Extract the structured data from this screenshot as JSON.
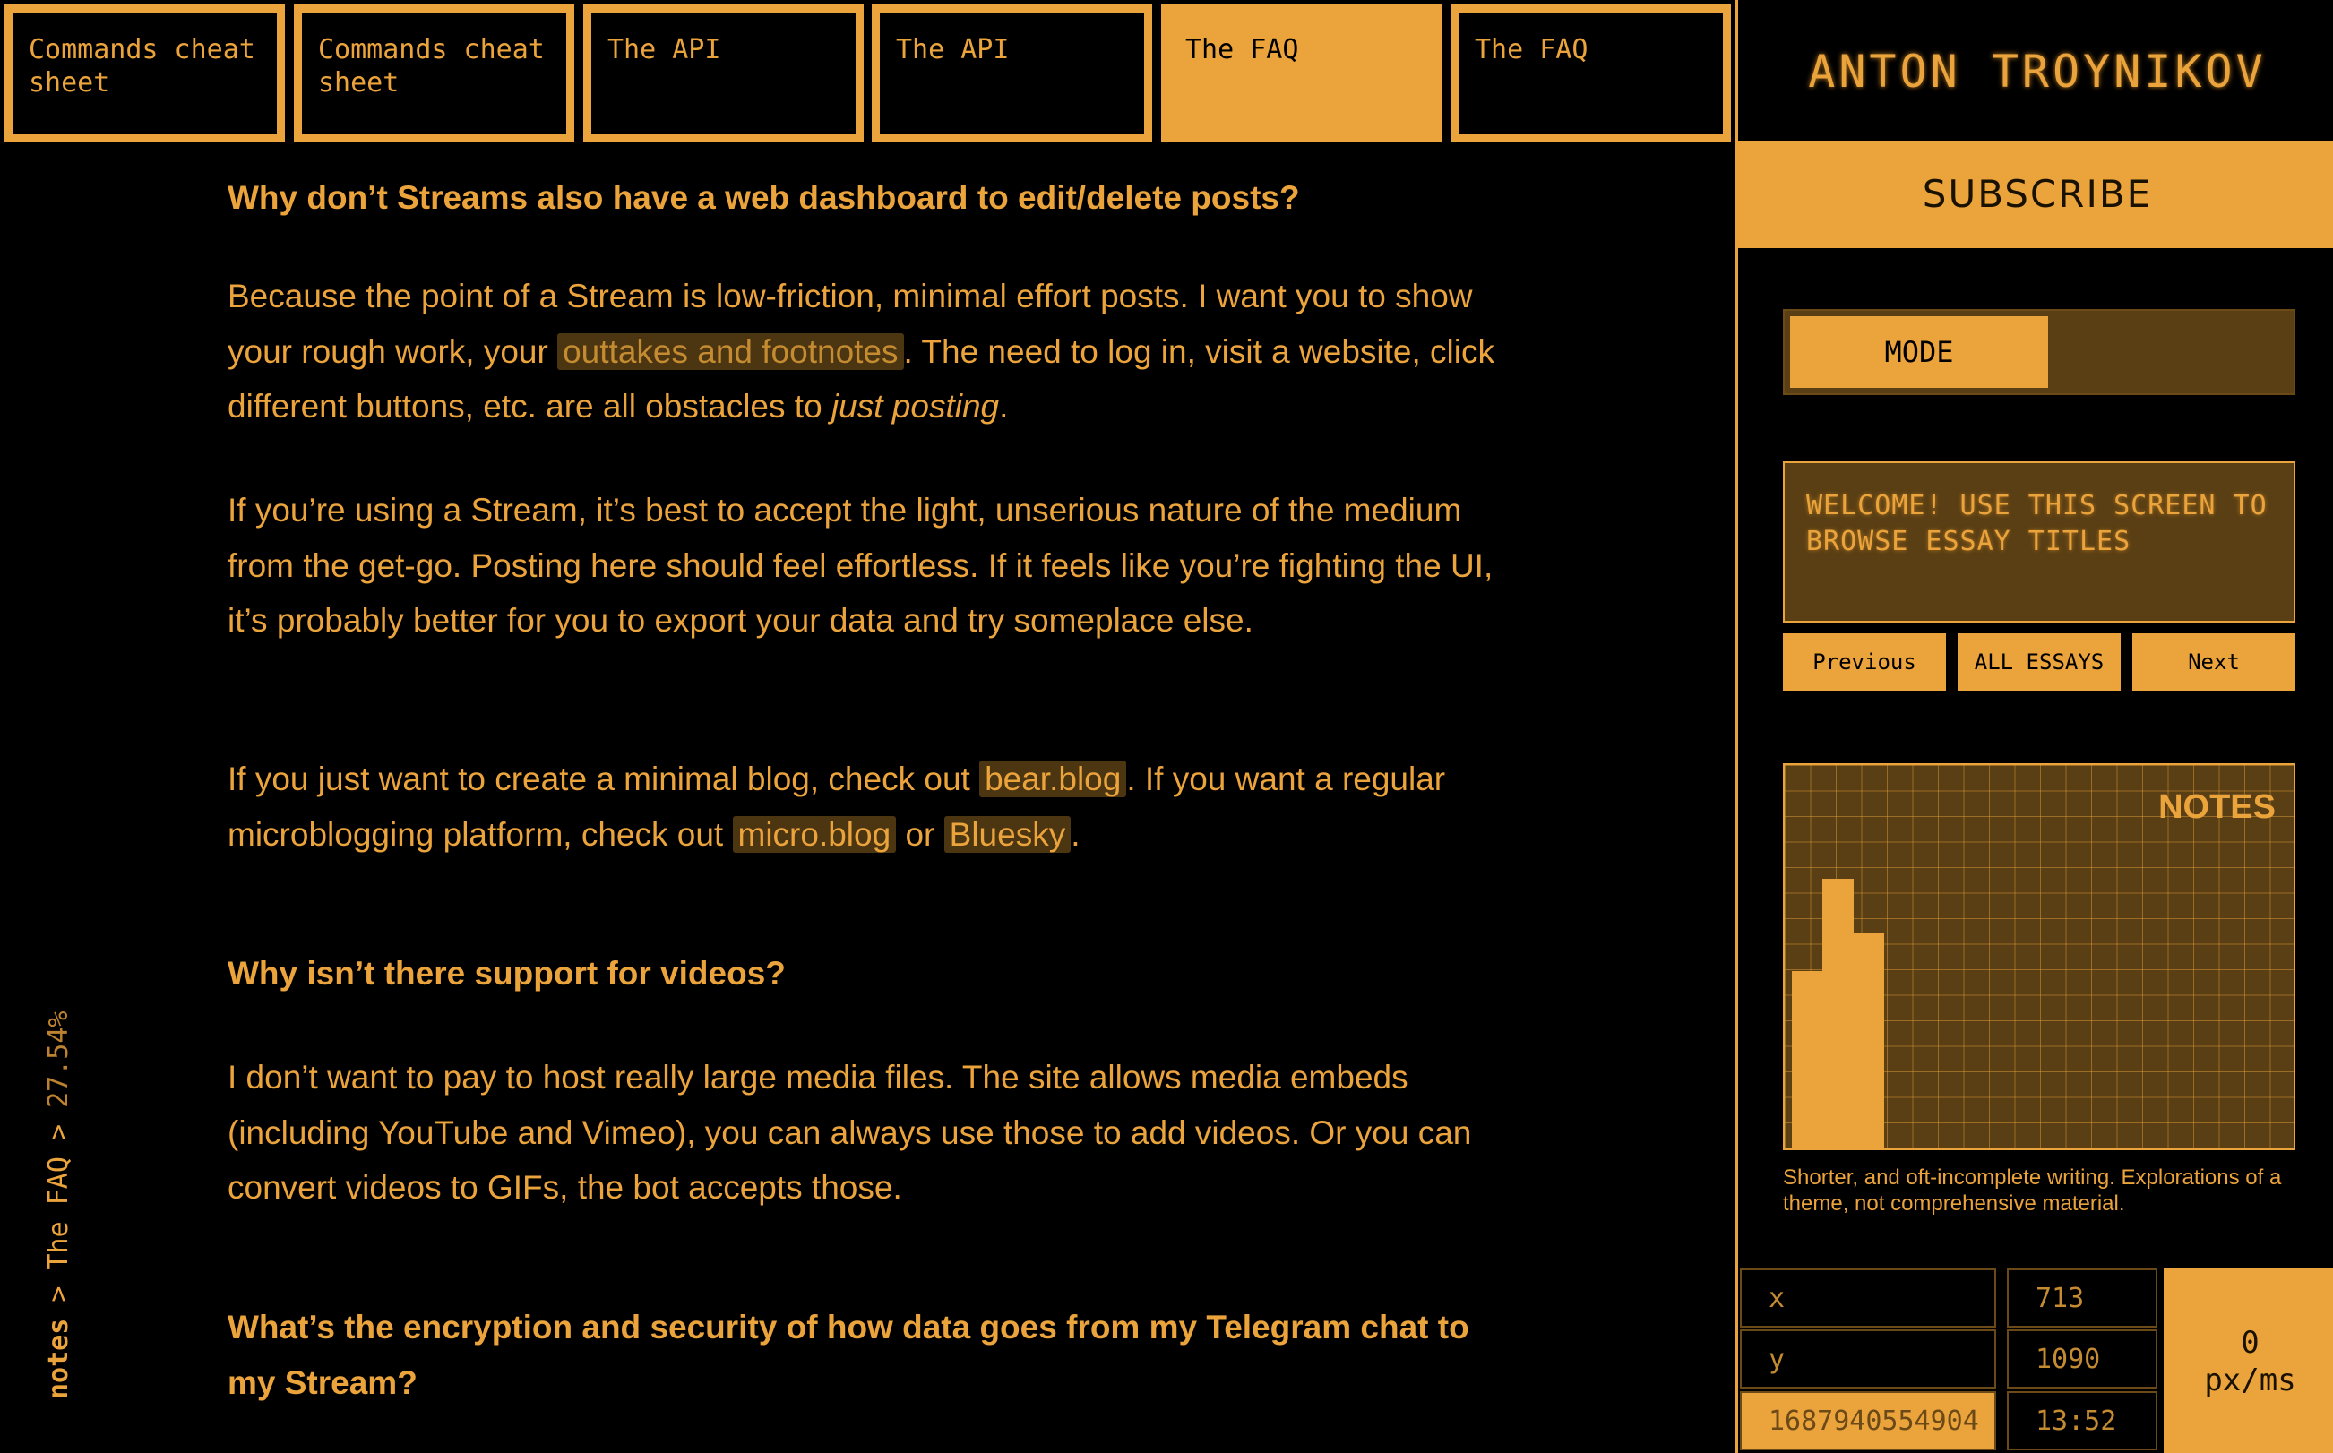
{
  "tabs": [
    {
      "label": "Commands cheat sheet",
      "active": false
    },
    {
      "label": "Commands cheat sheet",
      "active": false
    },
    {
      "label": "The API",
      "active": false
    },
    {
      "label": "The API",
      "active": false
    },
    {
      "label": "The FAQ",
      "active": true
    },
    {
      "label": "The FAQ",
      "active": false
    }
  ],
  "article": {
    "q1": "Why don’t Streams also have a web dashboard to edit/delete posts?",
    "p1_a": "Because the point of a Stream is low-friction, minimal effort posts. I want you to show your rough work, your ",
    "p1_link": "outtakes and footnotes",
    "p1_b": ". The need to log in, visit a website, click different buttons, etc. are all obstacles to ",
    "p1_em": "just posting",
    "p1_c": ".",
    "p2": "If you’re using a Stream, it’s best to accept the light, unserious nature of the medium from the get-go. Posting here should feel effortless. If it feels like you’re fighting the UI, it’s probably better for you to export your data and try someplace else.",
    "p3_a": "If you just want to create a minimal blog, check out ",
    "p3_link1": "bear.blog",
    "p3_b": ". If you want a regular microblogging platform, check out ",
    "p3_link2": "micro.blog",
    "p3_c": " or ",
    "p3_link3": "Bluesky",
    "p3_d": ".",
    "q2": "Why isn’t there support for videos?",
    "p4": "I don’t want to pay to host really large media files. The site allows media embeds (including YouTube and Vimeo), you can always use those to add videos. Or you can convert videos to GIFs, the bot accepts those.",
    "q3": "What’s the encryption and security of how data goes from my Telegram chat to my Stream?"
  },
  "breadcrumb": {
    "section": "notes",
    "sep1": " > ",
    "page": "The FAQ",
    "sep2": " > ",
    "progress": "27.54%"
  },
  "sidebar": {
    "brand": "ANTON TROYNIKOV",
    "subscribe": "SUBSCRIBE",
    "mode": "MODE",
    "screen_text": "WELCOME! USE THIS SCREEN TO BROWSE ESSAY TITLES",
    "prev": "Previous",
    "all": "ALL ESSAYS",
    "next": "Next",
    "graph_label": "NOTES",
    "graph_levels": [
      0.46,
      0.46,
      0.7,
      0.7,
      0.56,
      0.56
    ],
    "description": "Shorter, and oft-incomplete writing. Explorations of a theme, not comprehensive material."
  },
  "readout": {
    "x_label": "x",
    "x_value": "713",
    "y_label": "y",
    "y_value": "1090",
    "timestamp": "1687940554904",
    "time": "13:52",
    "speed_value": "0",
    "speed_unit": "px/ms"
  },
  "colors": {
    "accent": "#eba33c",
    "background": "#000000",
    "panel": "#5a3f14"
  }
}
